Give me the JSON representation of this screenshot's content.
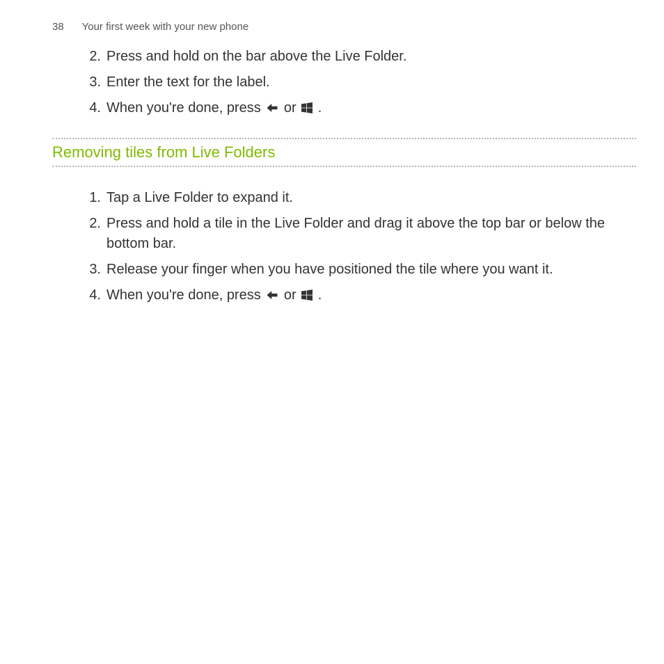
{
  "header": {
    "page_number": "38",
    "chapter": "Your first week with your new phone"
  },
  "list1": {
    "items": [
      {
        "num": "2.",
        "text": "Press and hold on the bar above the Live Folder."
      },
      {
        "num": "3.",
        "text": "Enter the text for the label."
      },
      {
        "num": "4.",
        "prefix": "When you're done, press ",
        "mid": " or ",
        "suffix": "."
      }
    ]
  },
  "section": {
    "heading": "Removing tiles from Live Folders"
  },
  "list2": {
    "items": [
      {
        "num": "1.",
        "text": "Tap a Live Folder to expand it."
      },
      {
        "num": "2.",
        "text": "Press and hold a tile in the Live Folder and drag it above the top bar or below the bottom bar."
      },
      {
        "num": "3.",
        "text": "Release your finger when you have positioned the tile where you want it."
      },
      {
        "num": "4.",
        "prefix": "When you're done, press ",
        "mid": " or ",
        "suffix": "."
      }
    ]
  }
}
